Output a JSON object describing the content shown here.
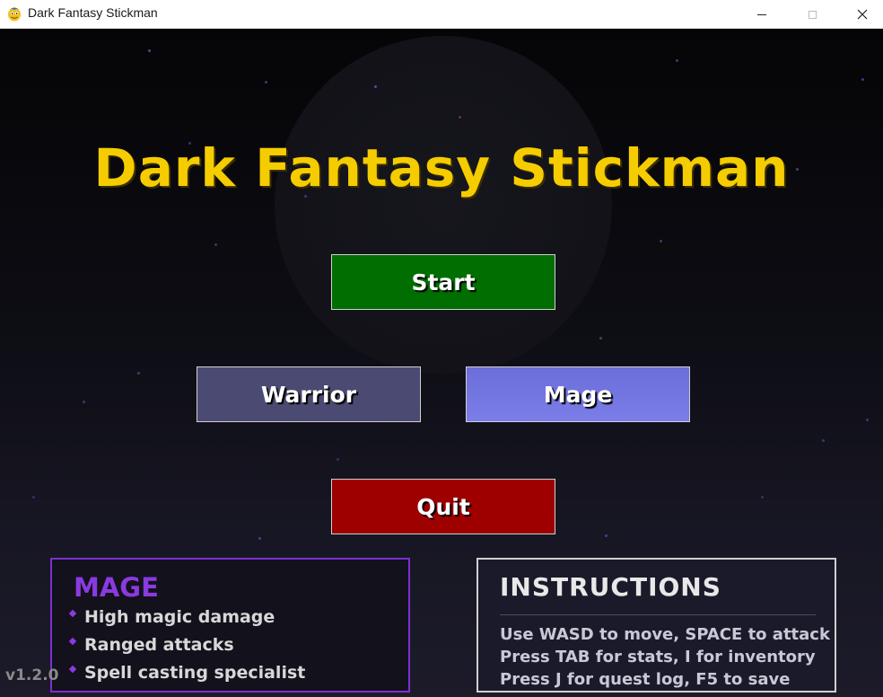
{
  "window": {
    "title": "Dark Fantasy Stickman",
    "app_icon": "pygame-snake-icon",
    "controls": {
      "minimize_icon": "minimize-icon",
      "maximize_icon": "maximize-icon",
      "close_glyph": "✕"
    }
  },
  "game": {
    "title": "Dark Fantasy Stickman",
    "title_color": "#f5cc00",
    "buttons": {
      "start": "Start",
      "warrior": "Warrior",
      "mage": "Mage",
      "quit": "Quit"
    },
    "button_colors": {
      "start": "#006e00",
      "warrior": "#4a4a72",
      "mage": "#7b7de8",
      "quit": "#9e0000"
    },
    "selected_class": "Mage",
    "class_panel": {
      "title": "MAGE",
      "accent": "#8a3ae0",
      "traits": [
        "High magic damage",
        "Ranged attacks",
        "Spell casting specialist"
      ]
    },
    "instructions": {
      "title": "INSTRUCTIONS",
      "lines": [
        "Use WASD to move, SPACE to attack",
        "Press TAB for stats, I for inventory",
        "Press J for quest log, F5 to save"
      ]
    },
    "version": "v1.2.0"
  }
}
